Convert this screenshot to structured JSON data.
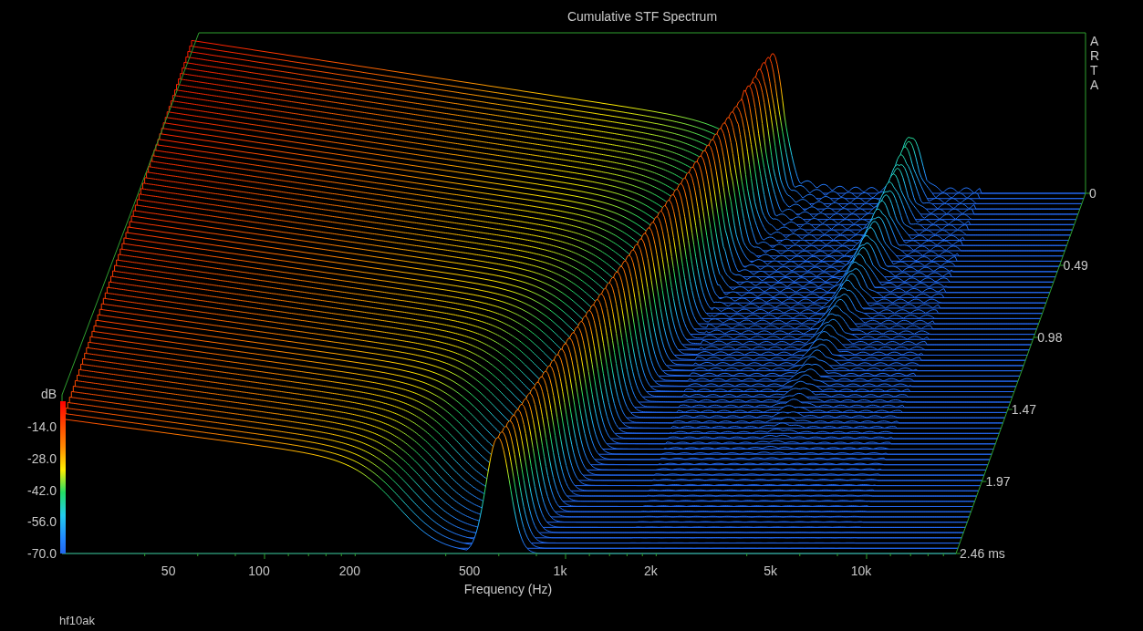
{
  "title": "Cumulative STF Spectrum",
  "brand": "ARTA",
  "y_axis": {
    "label": "dB",
    "ticks": [
      "-14.0",
      "-28.0",
      "-42.0",
      "-56.0",
      "-70.0"
    ]
  },
  "x_axis": {
    "label": "Frequency (Hz)",
    "ticks": [
      "50",
      "100",
      "200",
      "500",
      "1k",
      "2k",
      "5k",
      "10k"
    ]
  },
  "time_axis": {
    "ticks": [
      "0",
      "0.49",
      "0.98",
      "1.47",
      "1.97",
      "2.46 ms"
    ]
  },
  "file_name": "hf10ak"
}
